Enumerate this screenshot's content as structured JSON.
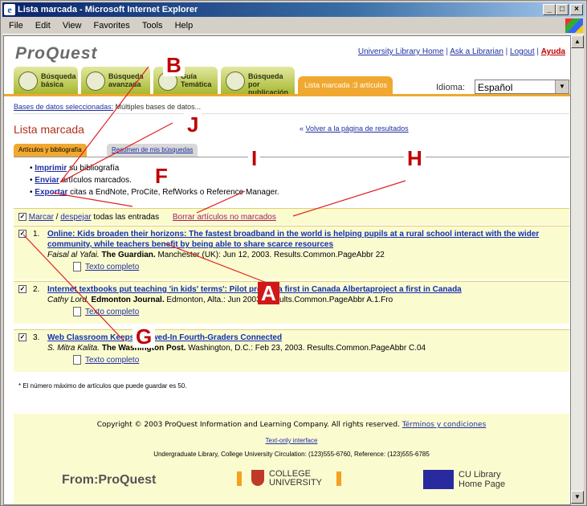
{
  "window": {
    "title": "Lista marcada - Microsoft Internet Explorer"
  },
  "menu": [
    "File",
    "Edit",
    "View",
    "Favorites",
    "Tools",
    "Help"
  ],
  "header": {
    "logo": "ProQuest",
    "links": [
      "University Library Home",
      "Ask a Librarian",
      "Logout"
    ],
    "help": "Ayuda",
    "tabs": [
      {
        "line1": "Búsqueda",
        "line2": "básica"
      },
      {
        "line1": "Búsqueda",
        "line2": "avanzada"
      },
      {
        "line1": "Guía",
        "line2": "Temática"
      },
      {
        "line1": "Búsqueda por",
        "line2": "publicación"
      }
    ],
    "active_tab": "Lista marcada :3 artículos",
    "idioma_label": "Idioma:",
    "idioma_value": "Español"
  },
  "db": {
    "label": "Bases de datos seleccionadas:",
    "value": "Múltiples bases de datos..."
  },
  "page_title": "Lista marcada",
  "back_link": "Volver a la página de resultados",
  "subtabs": [
    "Artículos y bibliografía",
    "Resumen de mis búsquedas"
  ],
  "actions": [
    {
      "link": "Imprimir",
      "rest": " su bibliografía"
    },
    {
      "link": "Enviar",
      "rest": " artículos marcados."
    },
    {
      "link": "Exportar",
      "rest": " citas a EndNote, ProCite, RefWorks o Reference Manager."
    }
  ],
  "marcar": {
    "marcar": "Marcar",
    "slash": " / ",
    "despejar": "despejar",
    "rest": " todas las entradas",
    "borrar": "Borrar artículos no marcados"
  },
  "articles": [
    {
      "num": "1.",
      "title": "Online: Kids broaden their horizons: The fastest broadband in the world is helping pupils at a rural school interact with the wider community, while teachers benefit by being able to share scarce resources",
      "author": "Faisal al Yafai.",
      "source": "The Guardian.",
      "rest": " Manchester (UK): Jun 12, 2003. Results.Common.PageAbbr 22",
      "full": "Texto completo"
    },
    {
      "num": "2.",
      "title": "Internet textbooks put teaching 'in kids' terms': Pilot project a first in Canada Albertaproject a first in Canada",
      "author": "Cathy Lord.",
      "source": "Edmonton Journal.",
      "rest": " Edmonton, Alta.: Jun 2003. Results.Common.PageAbbr A.1.Fro",
      "full": "Texto completo"
    },
    {
      "num": "3.",
      "title": "Web Classroom Keeps Snowed-In Fourth-Graders Connected",
      "author": "S. Mitra Kalita.",
      "source": "The Washington Post.",
      "rest": " Washington, D.C.: Feb 23, 2003. Results.Common.PageAbbr C.04",
      "full": "Texto completo"
    }
  ],
  "note": "* El número máximo de artículos que puede guardar es 50.",
  "footer": {
    "copyright": "Copyright © 2003 ProQuest Information and Learning Company. All rights reserved.",
    "terms": "Términos y condiciones",
    "textonly": "Text-only interface",
    "address": "Undergraduate Library, College University Circulation: (123)555-6760, Reference: (123)555-6785",
    "from": "From:ProQuest",
    "college1": "COLLEGE",
    "college2": "UNIVERSITY",
    "cul1": "CU Library",
    "cul2": "Home Page"
  },
  "labels": [
    "A",
    "B",
    "F",
    "G",
    "H",
    "I",
    "J"
  ]
}
